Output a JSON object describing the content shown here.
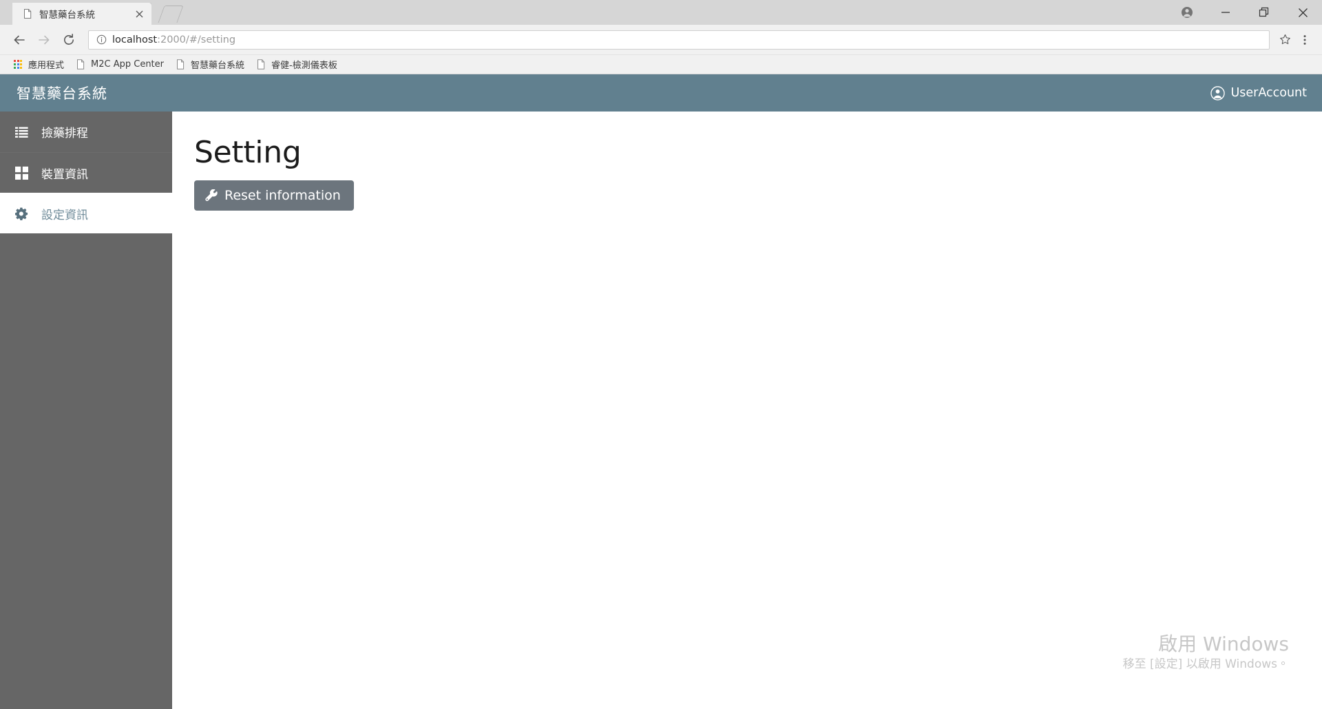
{
  "browser": {
    "tab": {
      "title": "智慧藥台系統",
      "favicon_icon": "page-icon",
      "close_icon": "close-icon"
    },
    "new_tab_icon": "new-tab-icon",
    "window_controls": {
      "profile_icon": "profile-icon",
      "minimize_icon": "minimize-icon",
      "restore_icon": "restore-icon",
      "close_icon": "close-icon"
    },
    "toolbar": {
      "back_icon": "back-arrow-icon",
      "forward_icon": "forward-arrow-icon",
      "reload_icon": "reload-icon",
      "site_info_icon": "info-circle-icon",
      "url_host": "localhost",
      "url_rest": ":2000/#/setting",
      "url_full": "localhost:2000/#/setting",
      "bookmark_star_icon": "star-icon",
      "menu_icon": "three-dot-menu-icon"
    },
    "bookmarks": [
      {
        "label": "應用程式",
        "icon": "apps-grid-icon"
      },
      {
        "label": "M2C App Center",
        "icon": "page-icon"
      },
      {
        "label": "智慧藥台系統",
        "icon": "page-icon"
      },
      {
        "label": "睿健-檢測儀表板",
        "icon": "page-icon"
      }
    ]
  },
  "app": {
    "header": {
      "brand": "智慧藥台系統",
      "user_account_label": "UserAccount",
      "user_account_icon": "user-circle-icon",
      "background_color": "#61808f"
    },
    "sidebar": {
      "background_color": "#666666",
      "items": [
        {
          "label": "撿藥排程",
          "icon": "list-icon",
          "active": false
        },
        {
          "label": "裝置資訊",
          "icon": "grid-icon",
          "active": false
        },
        {
          "label": "設定資訊",
          "icon": "gear-icon",
          "active": true
        }
      ]
    },
    "main": {
      "title": "Setting",
      "reset_button": {
        "label": "Reset information",
        "icon": "wrench-icon",
        "color": "#6c757d"
      }
    },
    "watermark": {
      "title": "啟用 Windows",
      "subtitle": "移至 [設定] 以啟用 Windows。"
    }
  }
}
